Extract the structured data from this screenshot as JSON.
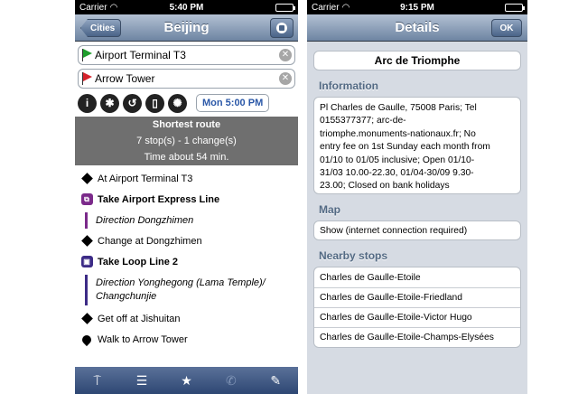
{
  "left": {
    "status": {
      "carrier": "Carrier",
      "time": "5:40 PM"
    },
    "nav": {
      "back_label": "Cities",
      "title": "Beijing"
    },
    "from_field": "Airport Terminal T3",
    "to_field": "Arrow Tower",
    "tools": {
      "datetime": "Mon 5:00 PM"
    },
    "summary": {
      "title": "Shortest route",
      "stops": "7 stop(s) - 1 change(s)",
      "time": "Time about 54 min."
    },
    "steps": [
      "At Airport Terminal T3",
      "Take Airport Express Line",
      "Direction Dongzhimen",
      "Change at Dongzhimen",
      "Take Loop Line 2",
      "Direction Yonghegong (Lama Temple)/",
      "Changchunjie",
      "Get off at Jishuitan",
      "Walk to Arrow Tower"
    ],
    "colors": {
      "express_line": "#7b2a8a",
      "loop_line": "#3c2b86"
    }
  },
  "right": {
    "status": {
      "carrier": "Carrier",
      "time": "9:15 PM"
    },
    "nav": {
      "title": "Details",
      "ok_label": "OK"
    },
    "place_name": "Arc de Triomphe",
    "info_header": "Information",
    "info_lines": [
      "Pl Charles de Gaulle, 75008 Paris; Tel",
      "0155377377; arc-de-",
      "triomphe.monuments-nationaux.fr; No",
      "entry fee on 1st Sunday each month from",
      "01/10 to 01/05 inclusive; Open 01/10-",
      "31/03 10.00-22.30, 01/04-30/09 9.30-",
      "23.00; Closed on bank holidays"
    ],
    "map_header": "Map",
    "map_row": "Show (internet connection required)",
    "nearby_header": "Nearby stops",
    "nearby": [
      "Charles de Gaulle-Etoile",
      "Charles de Gaulle-Etoile-Friedland",
      "Charles de Gaulle-Etoile-Victor Hugo",
      "Charles de Gaulle-Etoile-Champs-Elysées"
    ]
  }
}
